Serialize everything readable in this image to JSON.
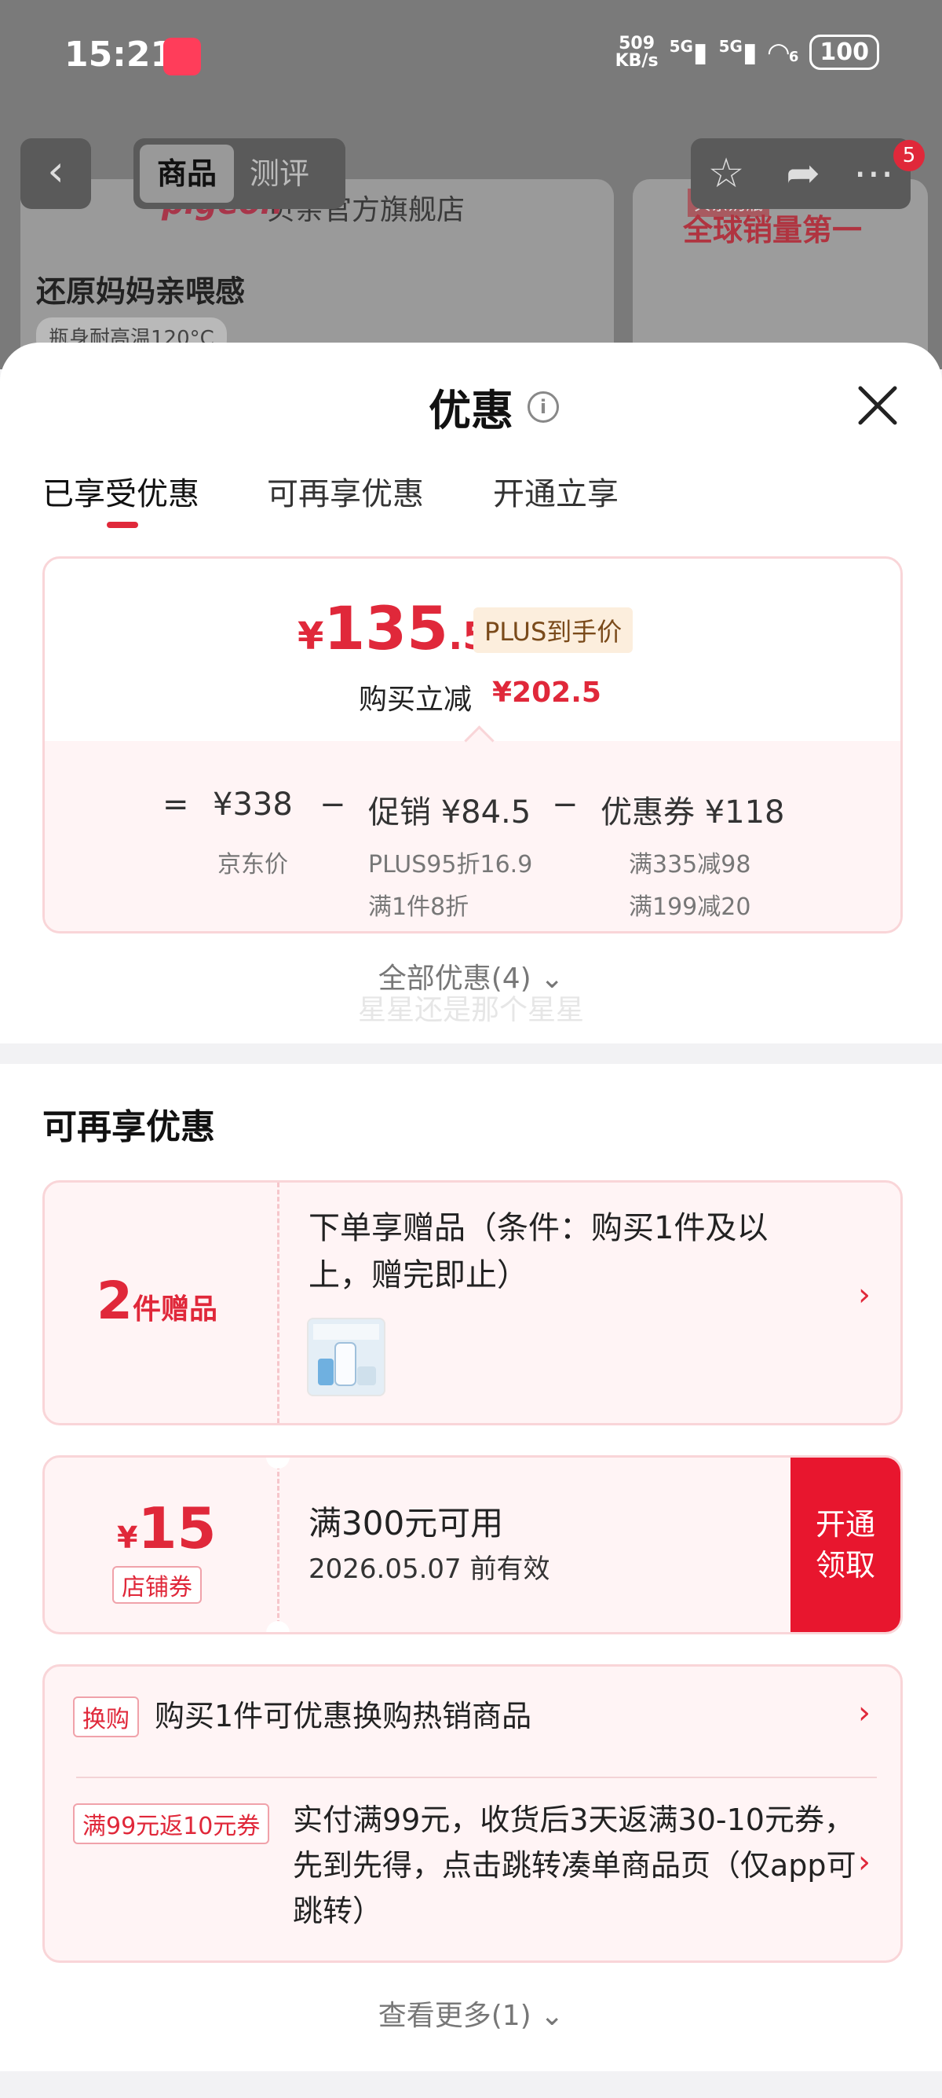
{
  "status_bar": {
    "time": "15:21",
    "net_speed_value": "509",
    "net_speed_unit": "KB/s",
    "signal1": "5G",
    "signal2": "5G",
    "wifi_sub": "6",
    "battery": "100"
  },
  "product_bg": {
    "brand_logo": "pigeon",
    "brand_name": "贝亲官方旗舰店",
    "slogan": "还原妈妈亲喂感",
    "tagline": "瓶身耐高温120°C",
    "right_badge": "贝亲奶瓶",
    "right_title": "全球销量第一"
  },
  "nav": {
    "tab_active": "商品",
    "tab_inactive": "测评",
    "cart_count": "5"
  },
  "sheet": {
    "title": "优惠",
    "tabs": [
      "已享受优惠",
      "可再享优惠",
      "开通立享"
    ],
    "price_card": {
      "currency": "¥",
      "price_int": "135",
      "price_dec": ".5",
      "plus_label": "PLUS到手价",
      "save_label": "购买立减",
      "save_value": "¥202.5",
      "eq_sign": "=",
      "minus_sign": "−",
      "jd_price": "¥338",
      "jd_price_label": "京东价",
      "promo_label": "促销 ¥84.5",
      "promo_detail1": "PLUS95折16.9",
      "promo_detail2": "满1件8折",
      "coupon_label": "优惠券 ¥118",
      "coupon_detail1": "满335减98",
      "coupon_detail2": "满199减20"
    },
    "all_offers": "全部优惠(4)",
    "watermark": "星星还是那个星星",
    "more_section_title": "可再享优惠",
    "gift": {
      "count": "2",
      "unit": "件赠品",
      "text": "下单享赠品（条件：购买1件及以上，赠完即止）"
    },
    "coupon": {
      "currency": "¥",
      "value": "15",
      "tag": "店铺券",
      "condition": "满300元可用",
      "valid": "2026.05.07 前有效",
      "button_line1": "开通",
      "button_line2": "领取"
    },
    "promos": [
      {
        "tag": "换购",
        "text": "购买1件可优惠换购热销商品"
      },
      {
        "tag": "满99元返10元券",
        "text": "实付满99元，收货后3天返满30-10元券，先到先得，点击跳转凑单商品页（仅app可跳转）"
      }
    ],
    "view_more": "查看更多(1)"
  },
  "colors": {
    "accent": "#e0283a",
    "card_bg": "#fff4f5",
    "card_border": "#f9d5d8",
    "plus_bg": "#fceedd"
  }
}
